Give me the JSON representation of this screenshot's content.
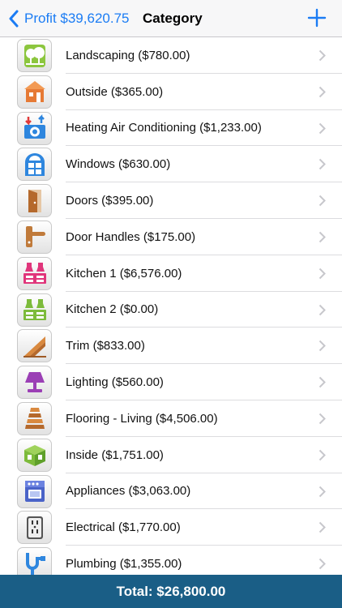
{
  "nav": {
    "back_label": "Profit $39,620.75",
    "title": "Category"
  },
  "categories": [
    {
      "label": "Landscaping ($780.00)",
      "icon": "tree-icon"
    },
    {
      "label": "Outside ($365.00)",
      "icon": "house-icon"
    },
    {
      "label": "Heating Air Conditioning ($1,233.00)",
      "icon": "hvac-icon"
    },
    {
      "label": "Windows ($630.00)",
      "icon": "window-icon"
    },
    {
      "label": "Doors ($395.00)",
      "icon": "door-icon"
    },
    {
      "label": "Door Handles ($175.00)",
      "icon": "door-handle-icon"
    },
    {
      "label": "Kitchen 1 ($6,576.00)",
      "icon": "kitchen-pink-icon"
    },
    {
      "label": "Kitchen 2 ($0.00)",
      "icon": "kitchen-green-icon"
    },
    {
      "label": "Trim ($833.00)",
      "icon": "trim-icon"
    },
    {
      "label": "Lighting ($560.00)",
      "icon": "lamp-icon"
    },
    {
      "label": "Flooring - Living ($4,506.00)",
      "icon": "flooring-icon"
    },
    {
      "label": "Inside ($1,751.00)",
      "icon": "box-icon"
    },
    {
      "label": "Appliances ($3,063.00)",
      "icon": "stove-icon"
    },
    {
      "label": "Electrical ($1,770.00)",
      "icon": "outlet-icon"
    },
    {
      "label": "Plumbing ($1,355.00)",
      "icon": "pipe-icon"
    }
  ],
  "footer": {
    "total": "Total: $26,800.00"
  },
  "colors": {
    "accent": "#1b7cf4",
    "footer_bg": "#1a5e86"
  }
}
